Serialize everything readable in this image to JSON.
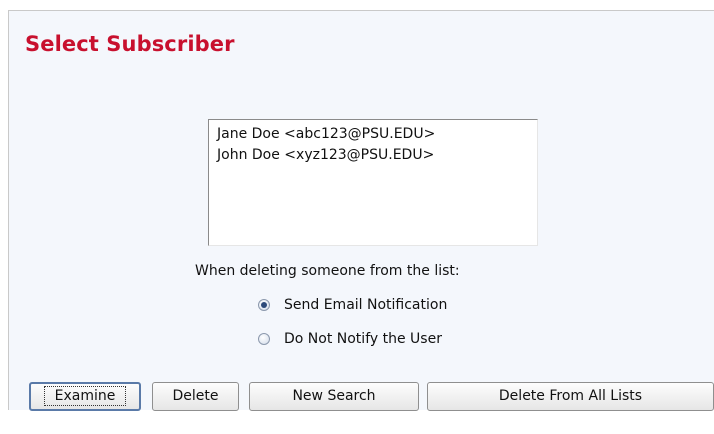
{
  "page": {
    "title": "Select Subscriber"
  },
  "subscribers": {
    "options": [
      "Jane Doe <abc123@PSU.EDU>",
      "John Doe <xyz123@PSU.EDU>"
    ]
  },
  "deletion": {
    "prompt": "When deleting someone from the list:",
    "options": [
      {
        "label": "Send Email Notification",
        "checked": true
      },
      {
        "label": "Do Not Notify the User",
        "checked": false
      }
    ]
  },
  "buttons": {
    "examine": "Examine",
    "delete": "Delete",
    "new_search": "New Search",
    "delete_all": "Delete From All Lists"
  },
  "colors": {
    "title": "#c8102e",
    "panel_background": "#f4f7fc"
  }
}
